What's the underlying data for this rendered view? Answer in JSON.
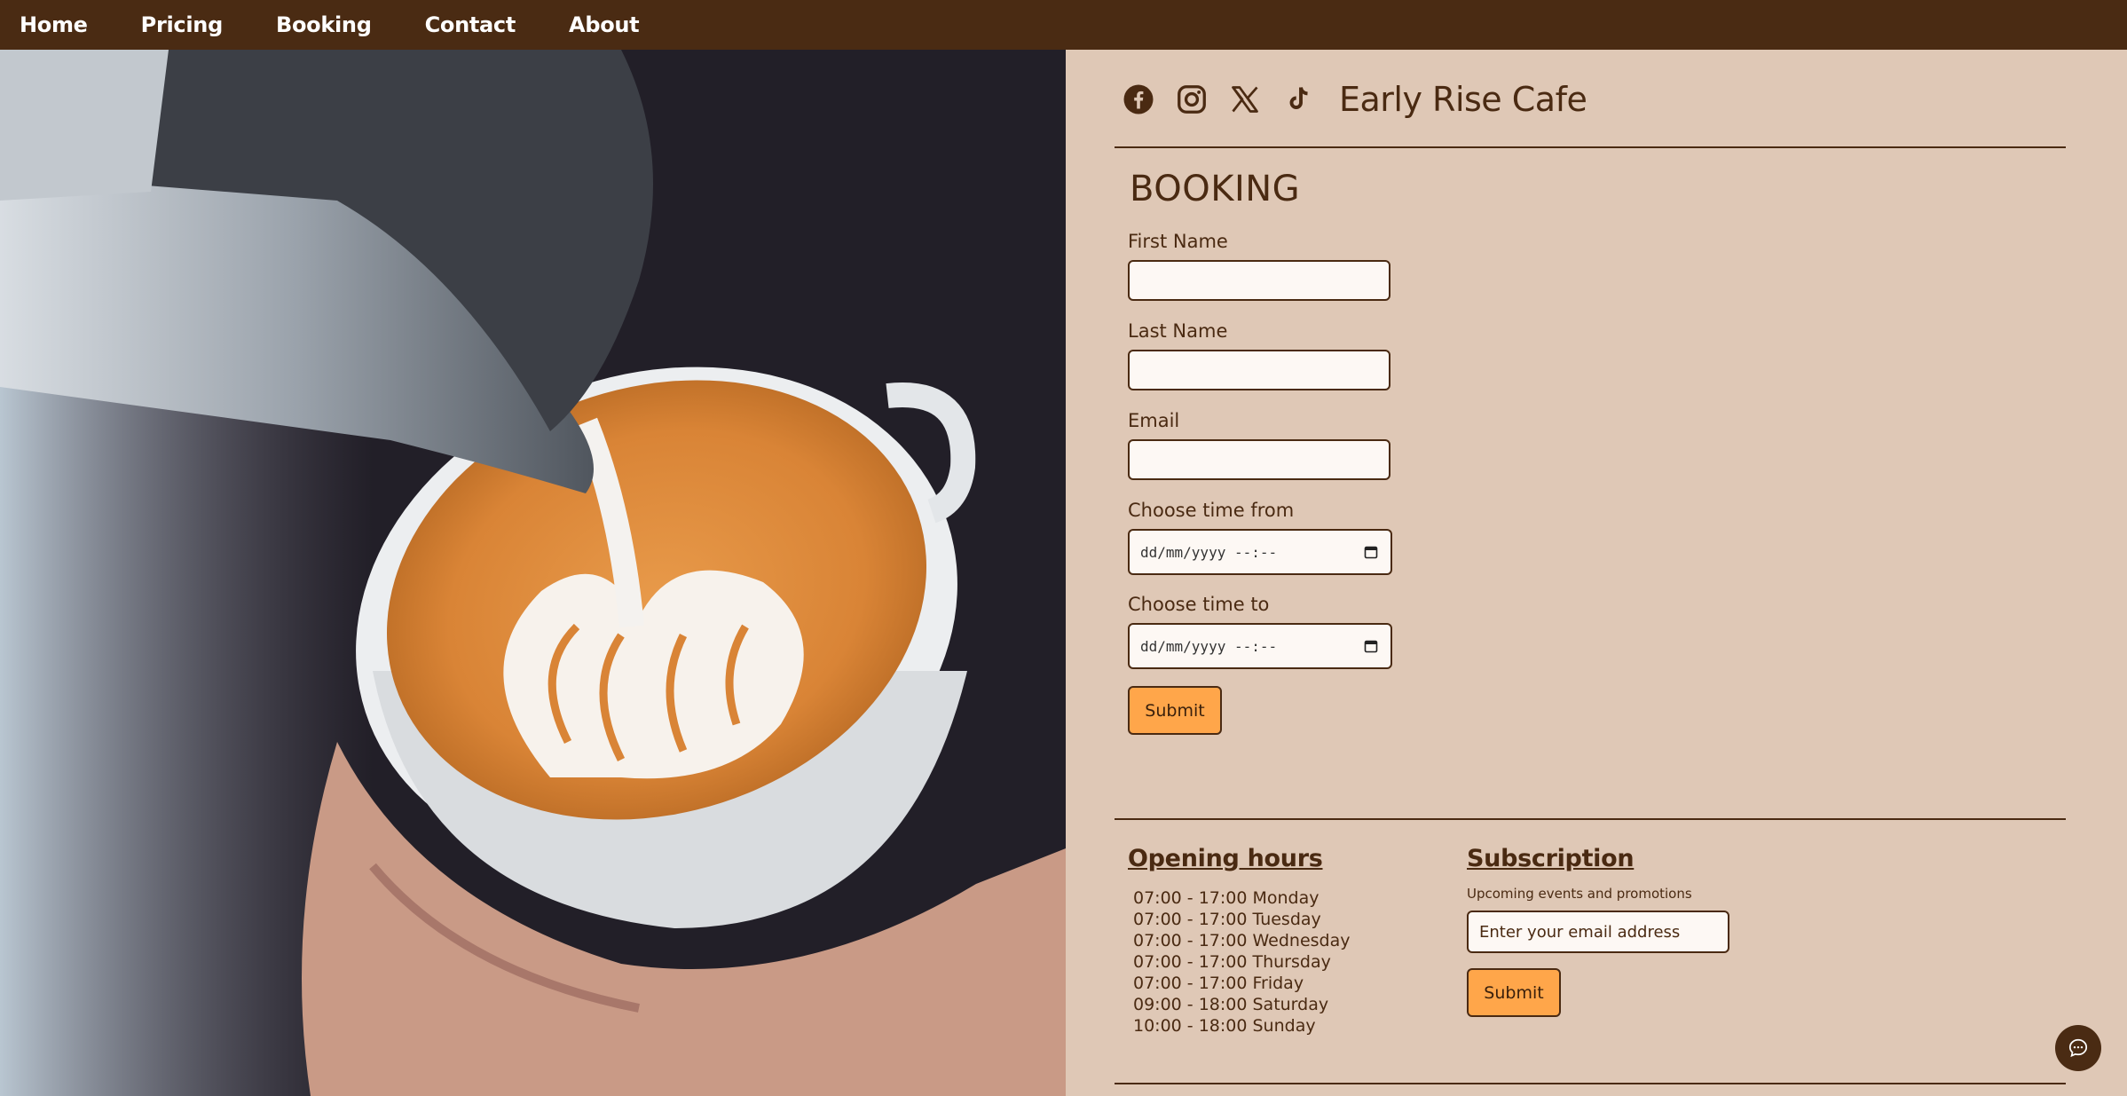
{
  "nav": {
    "items": [
      {
        "label": "Home"
      },
      {
        "label": "Pricing"
      },
      {
        "label": "Booking"
      },
      {
        "label": "Contact"
      },
      {
        "label": "About"
      }
    ]
  },
  "brand": {
    "name": "Early Rise Cafe",
    "social_icons": [
      "facebook-icon",
      "instagram-icon",
      "x-icon",
      "tiktok-icon"
    ]
  },
  "booking": {
    "title": "BOOKING",
    "first_name_label": "First Name",
    "last_name_label": "Last Name",
    "email_label": "Email",
    "time_from_label": "Choose time from",
    "time_from_value": "dd/mm/yyyy --:--",
    "time_to_label": "Choose time to",
    "time_to_value": "dd/mm/yyyy --:--",
    "submit_label": "Submit"
  },
  "footer": {
    "hours_title": "Opening hours",
    "hours": [
      "07:00 - 17:00 Monday",
      "07:00 - 17:00 Tuesday",
      "07:00 - 17:00 Wednesday",
      "07:00 - 17:00 Thursday",
      "07:00 - 17:00 Friday",
      "09:00 - 18:00 Saturday",
      "10:00 - 18:00 Sunday"
    ],
    "subscription_title": "Subscription",
    "subscription_text": "Upcoming events and promotions",
    "subscription_placeholder": "Enter your email address",
    "subscription_submit": "Submit"
  },
  "colors": {
    "nav_bg": "#4a2b13",
    "page_bg": "#dfc8b6",
    "accent": "#ffa64a",
    "text": "#4a2a12"
  }
}
